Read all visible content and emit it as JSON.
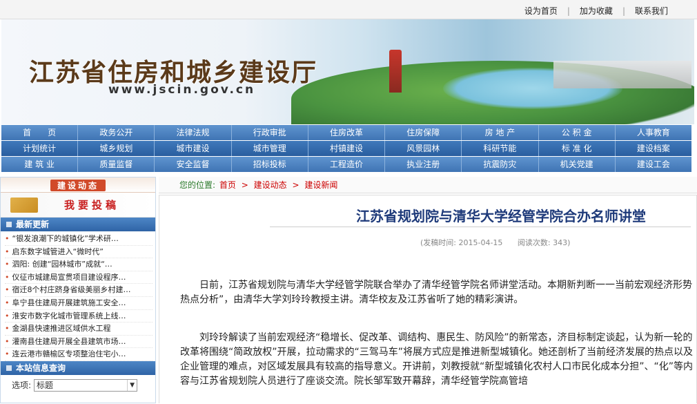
{
  "topbar": {
    "links": [
      "设为首页",
      "加为收藏",
      "联系我们"
    ]
  },
  "banner": {
    "site_title": "江苏省住房和城乡建设厅",
    "site_url": "www.jscin.gov.cn"
  },
  "nav": {
    "rows": [
      [
        "首　　页",
        "政务公开",
        "法律法规",
        "行政审批",
        "住房改革",
        "住房保障",
        "房 地 产",
        "公 积 金",
        "人事教育"
      ],
      [
        "计划统计",
        "城乡规划",
        "城市建设",
        "城市管理",
        "村镇建设",
        "风景园林",
        "科研节能",
        "标 准 化",
        "建设档案"
      ],
      [
        "建 筑 业",
        "质量监督",
        "安全监督",
        "招标投标",
        "工程造价",
        "执业注册",
        "抗震防灾",
        "机关党建",
        "建设工会"
      ]
    ]
  },
  "sidebar": {
    "section_title": "建设动态",
    "submit_label": "我要投稿",
    "latest_title": "最新更新",
    "latest_items": [
      "“银发浪潮下的城镇化”学术研…",
      "启东数字城管进入“微时代”",
      "泗阳: 创建“园林城市”成就“…",
      "仪征市城建局宣贯项目建设程序…",
      "宿迁8个村庄跻身省级美丽乡村建…",
      "阜宁县住建局开展建筑施工安全…",
      "淮安市数字化城市管理系统上线…",
      "金湖县快速推进区域供水工程",
      "灌南县住建局开展全县建筑市场…",
      "连云港市赣榆区专项整治住宅小…"
    ],
    "search_title": "本站信息查询",
    "search_label": "选项:",
    "search_selected": "标题"
  },
  "breadcrumb": {
    "label": "您的位置:",
    "items": [
      "首页",
      "建设动态",
      "建设新闻"
    ]
  },
  "article": {
    "title": "江苏省规划院与清华大学经管学院合办名师讲堂",
    "publish_time": "(发稿时间: 2015-04-15",
    "read_count": "阅读次数: 343)",
    "paragraphs": [
      "日前，江苏省规划院与清华大学经管学院联合举办了清华经管学院名师讲堂活动。本期新判断一一当前宏观经济形势热点分析”，由清华大学刘玲玲教授主讲。清华校友及江苏省听了她的精彩演讲。",
      "刘玲玲解读了当前宏观经济“稳增长、促改革、调结构、惠民生、防风险”的新常态，济目标制定谈起，认为新一轮的改革将围绕“简政放权”开展，拉动需求的“三驾马车”将展方式应是推进新型城镇化。她还剖析了当前经济发展的热点以及企业管理的难点，对区域发展具有较高的指导意义。开讲前，刘教授就“新型城镇化农村人口市民化成本分担”、“化”等内容与江苏省规划院人员进行了座谈交流。院长邹军致开幕辞，清华经管学院高管培"
    ]
  }
}
